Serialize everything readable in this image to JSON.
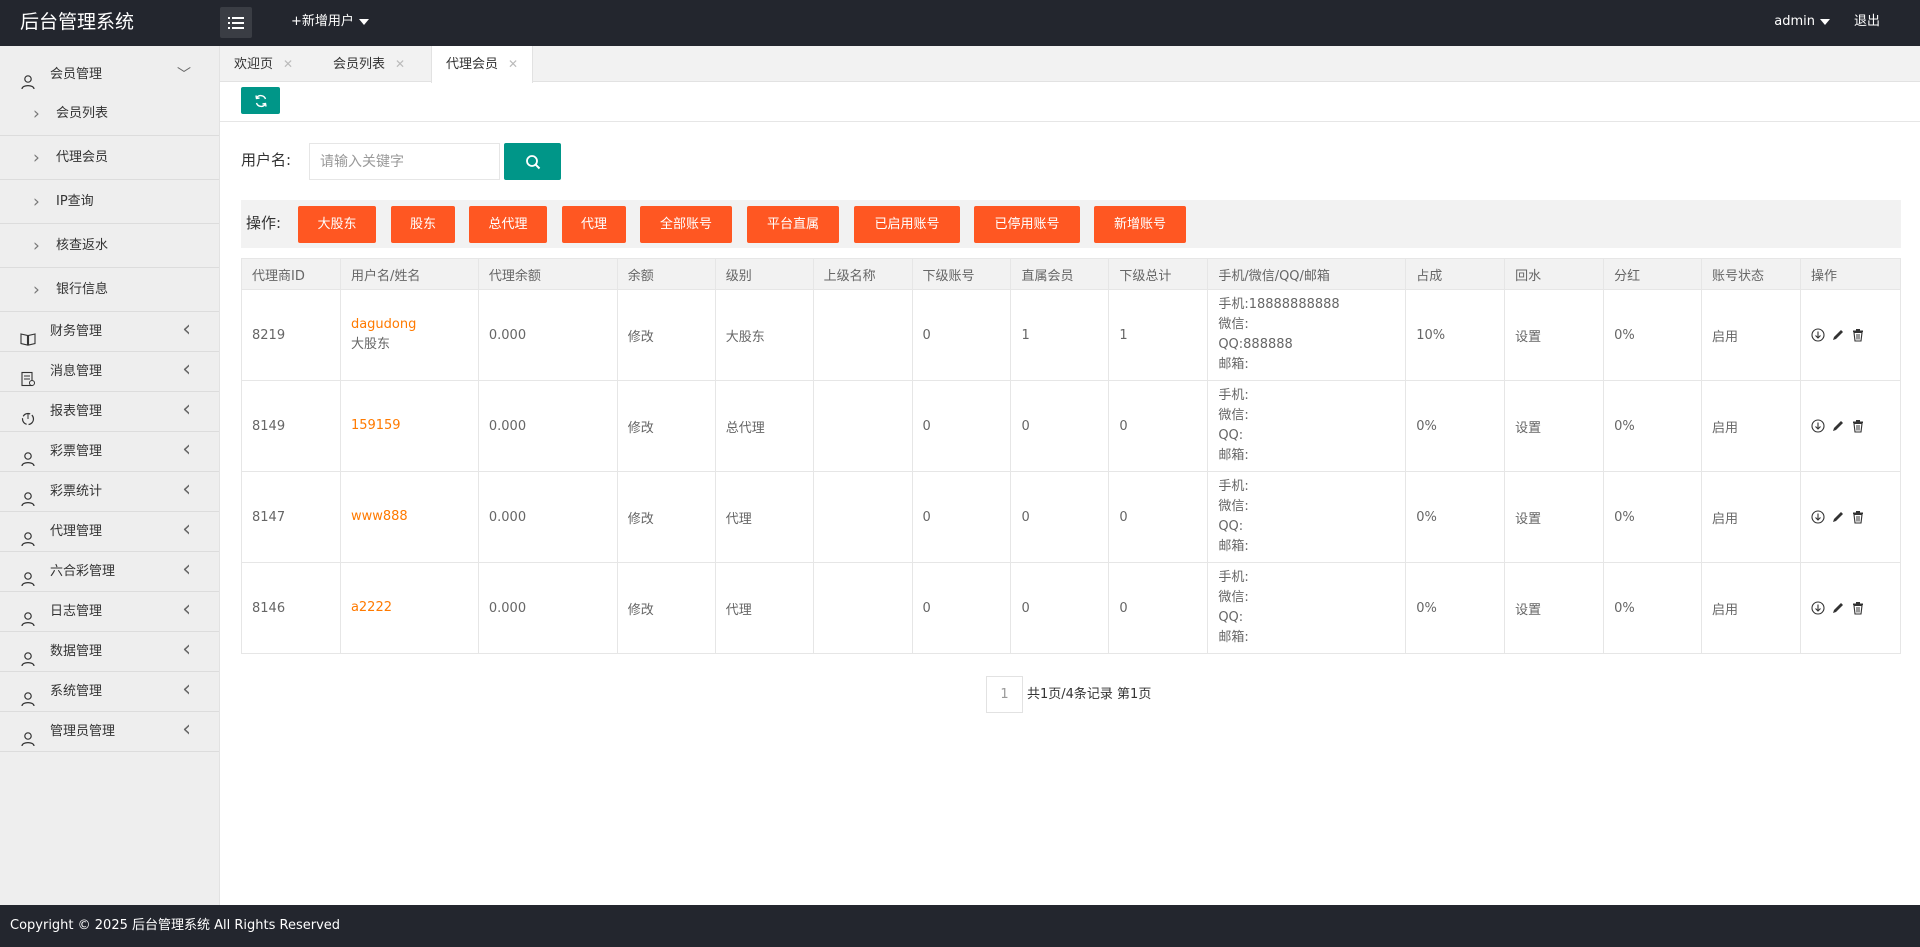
{
  "header": {
    "title": "后台管理系统",
    "add_user": "+新增用户",
    "admin": "admin",
    "logout": "退出"
  },
  "sidebar": {
    "groups": [
      {
        "label": "会员管理",
        "icon": "user-icon",
        "open": true,
        "children": [
          "会员列表",
          "代理会员",
          "IP查询",
          "核查返水",
          "银行信息"
        ]
      },
      {
        "label": "财务管理",
        "icon": "book-icon"
      },
      {
        "label": "消息管理",
        "icon": "message-icon"
      },
      {
        "label": "报表管理",
        "icon": "report-icon"
      },
      {
        "label": "彩票管理",
        "icon": "user-icon"
      },
      {
        "label": "彩票统计",
        "icon": "user-icon"
      },
      {
        "label": "代理管理",
        "icon": "user-icon"
      },
      {
        "label": "六合彩管理",
        "icon": "user-icon"
      },
      {
        "label": "日志管理",
        "icon": "user-icon"
      },
      {
        "label": "数据管理",
        "icon": "user-icon"
      },
      {
        "label": "系统管理",
        "icon": "user-icon"
      },
      {
        "label": "管理员管理",
        "icon": "user-icon"
      }
    ]
  },
  "tabs": [
    {
      "label": "欢迎页"
    },
    {
      "label": "会员列表"
    },
    {
      "label": "代理会员",
      "active": true
    }
  ],
  "search": {
    "label": "用户名:",
    "placeholder": "请输入关键字"
  },
  "ops": {
    "label": "操作:",
    "buttons": [
      "大股东",
      "股东",
      "总代理",
      "代理",
      "全部账号",
      "平台直属",
      "已启用账号",
      "已停用账号",
      "新增账号"
    ]
  },
  "table": {
    "headers": [
      "代理商ID",
      "用户名/姓名",
      "代理余额",
      "余额",
      "级别",
      "上级名称",
      "下级账号",
      "直属会员",
      "下级总计",
      "手机/微信/QQ/邮箱",
      "占成",
      "回水",
      "分红",
      "账号状态",
      "操作"
    ],
    "rows": [
      {
        "id": "8219",
        "username": "dagudong",
        "realname": "大股东",
        "agent_balance": "0.000",
        "balance": "修改",
        "level": "大股东",
        "parent": "",
        "sub_accounts": "0",
        "direct_members": "1",
        "sub_total": "1",
        "phone": "手机:18888888888",
        "wechat": "微信:",
        "qq": "QQ:888888",
        "email": "邮箱:",
        "share": "10%",
        "rebate": "设置",
        "dividend": "0%",
        "status": "启用"
      },
      {
        "id": "8149",
        "username": "159159",
        "realname": "",
        "agent_balance": "0.000",
        "balance": "修改",
        "level": "总代理",
        "parent": "",
        "sub_accounts": "0",
        "direct_members": "0",
        "sub_total": "0",
        "phone": "手机:",
        "wechat": "微信:",
        "qq": "QQ:",
        "email": "邮箱:",
        "share": "0%",
        "rebate": "设置",
        "dividend": "0%",
        "status": "启用"
      },
      {
        "id": "8147",
        "username": "www888",
        "realname": "",
        "agent_balance": "0.000",
        "balance": "修改",
        "level": "代理",
        "parent": "",
        "sub_accounts": "0",
        "direct_members": "0",
        "sub_total": "0",
        "phone": "手机:",
        "wechat": "微信:",
        "qq": "QQ:",
        "email": "邮箱:",
        "share": "0%",
        "rebate": "设置",
        "dividend": "0%",
        "status": "启用"
      },
      {
        "id": "8146",
        "username": "a2222",
        "realname": "",
        "agent_balance": "0.000",
        "balance": "修改",
        "level": "代理",
        "parent": "",
        "sub_accounts": "0",
        "direct_members": "0",
        "sub_total": "0",
        "phone": "手机:",
        "wechat": "微信:",
        "qq": "QQ:",
        "email": "邮箱:",
        "share": "0%",
        "rebate": "设置",
        "dividend": "0%",
        "status": "启用"
      }
    ]
  },
  "pagination": {
    "current": "1",
    "info": "共1页/4条记录 第1页"
  },
  "footer": {
    "text": "Copyright © 2025 后台管理系统 All Rights Reserved"
  },
  "colors": {
    "header_bg": "#23262e",
    "accent_teal": "#009688",
    "accent_orange": "#ff5722",
    "link_orange": "#ff7a00"
  }
}
